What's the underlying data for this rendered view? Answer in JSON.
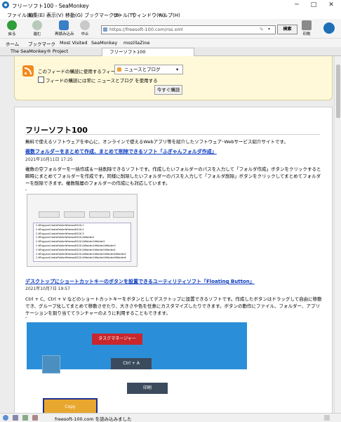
{
  "window": {
    "title": "フリーソフト100 - SeaMonkey",
    "controls": [
      "─",
      "□",
      "✕"
    ]
  },
  "menu": [
    "ファイル(F)",
    "編集(E)",
    "表示(V)",
    "移動(G)",
    "ブックマーク(B)",
    "ツール(T)",
    "ウィンドウ(W)",
    "ヘルプ(H)"
  ],
  "toolbar": {
    "back": "戻る",
    "forward": "進む",
    "reload": "再読み込み",
    "stop": "中止",
    "url": "https://freesoft-100.com/rss.xml",
    "search": "検索",
    "print": "印刷"
  },
  "bookmarks": [
    "ホーム",
    "ブックマーク",
    "Most Visited",
    "SeaMonkey",
    "mozillaZine"
  ],
  "tabs": [
    "The SeaMonkey® Project",
    "フリーソフト100"
  ],
  "feed": {
    "label": "このフィードの購読に使用するフィードリーダー:",
    "reader": "ニュースとブログ",
    "always": "フィードの購読には常に ニュースとブログ を使用する",
    "subscribe": "今すぐ購読"
  },
  "page": {
    "title": "フリーソフト100",
    "subtitle": "無料で使えるソフトウェアを中心に、オンラインで使えるWebアプリ等を紹介したソフトウェア･Webサービス紹介サイトです。",
    "articles": [
      {
        "title": "複数フォルダーをまとめて作成、まとめて削除できるソフト「ふぎゃんフォルダ作成」",
        "date": "2021年10月11日 17:25",
        "body": "複数の空フォルダーを一括作成＆一括削除できるソフトです。作成したいフォルダーのパスを入力して「フォルダ作成」ボタンをクリックすると瞬時にまとめてフォルダーを作成です。同様に削除したいフォルダーのパスを入力して「フォルダ削除」ボタンをクリックしてまとめてフォルダーを削除できます。複数階層のフォルダーの作成にも対応しています。"
      },
      {
        "title": "デスクトップにショートカットキーのボタンを設置できるユーティリティソフト「Floating Button」",
        "date": "2021年10月7日 19:57",
        "body": "Ctrl + C、Ctrl + V などのショートカットキーをボタンとしてデスクトップに設置できるソフトです。作成したボタンはドラッグして自由に移動でき、グループ化してまとめて移動させたり、大きさや色を任意にカスタマイズしたりできます。ボタンの動作にファイル、フォルダー、アプリケーションを割り当ててランチャーのように利用することもできます。"
      }
    ],
    "shot1_lines": [
      "C:¥FugyanCreateFolder¥freesoft100-1",
      "C:¥FugyanCreateFolder¥freesoft100-2",
      "C:¥FugyanCreateFolder¥freesoft100-3",
      "C:¥FugyanCreateFolder¥freesoft100-4¥folder1",
      "C:¥FugyanCreateFolder¥freesoft100-4¥folder1¥folder2",
      "C:¥FugyanCreateFolder¥freesoft100-4¥folder1¥folder2¥folder3",
      "C:¥FugyanCreateFolder¥freesoft100-4¥folder1¥folder2¥folder4",
      "C:¥FugyanCreateFolder¥freesoft100-4¥folder1¥folder2¥folder4¥folder5",
      "C:¥FugyanCreateFolder¥freesoft100-4¥folder1¥folder2¥folder4¥folder6"
    ],
    "shot2_buttons": [
      "タスクマネージャー",
      "Ctrl + A",
      "印刷",
      "Copy"
    ]
  },
  "status": "freesoft-100.com を読み込みました",
  "colors": {
    "accent": "#1d6fb8",
    "link": "#0a3ac0",
    "feed_bg": "#fff9d9",
    "rss": "#f28a1f"
  }
}
